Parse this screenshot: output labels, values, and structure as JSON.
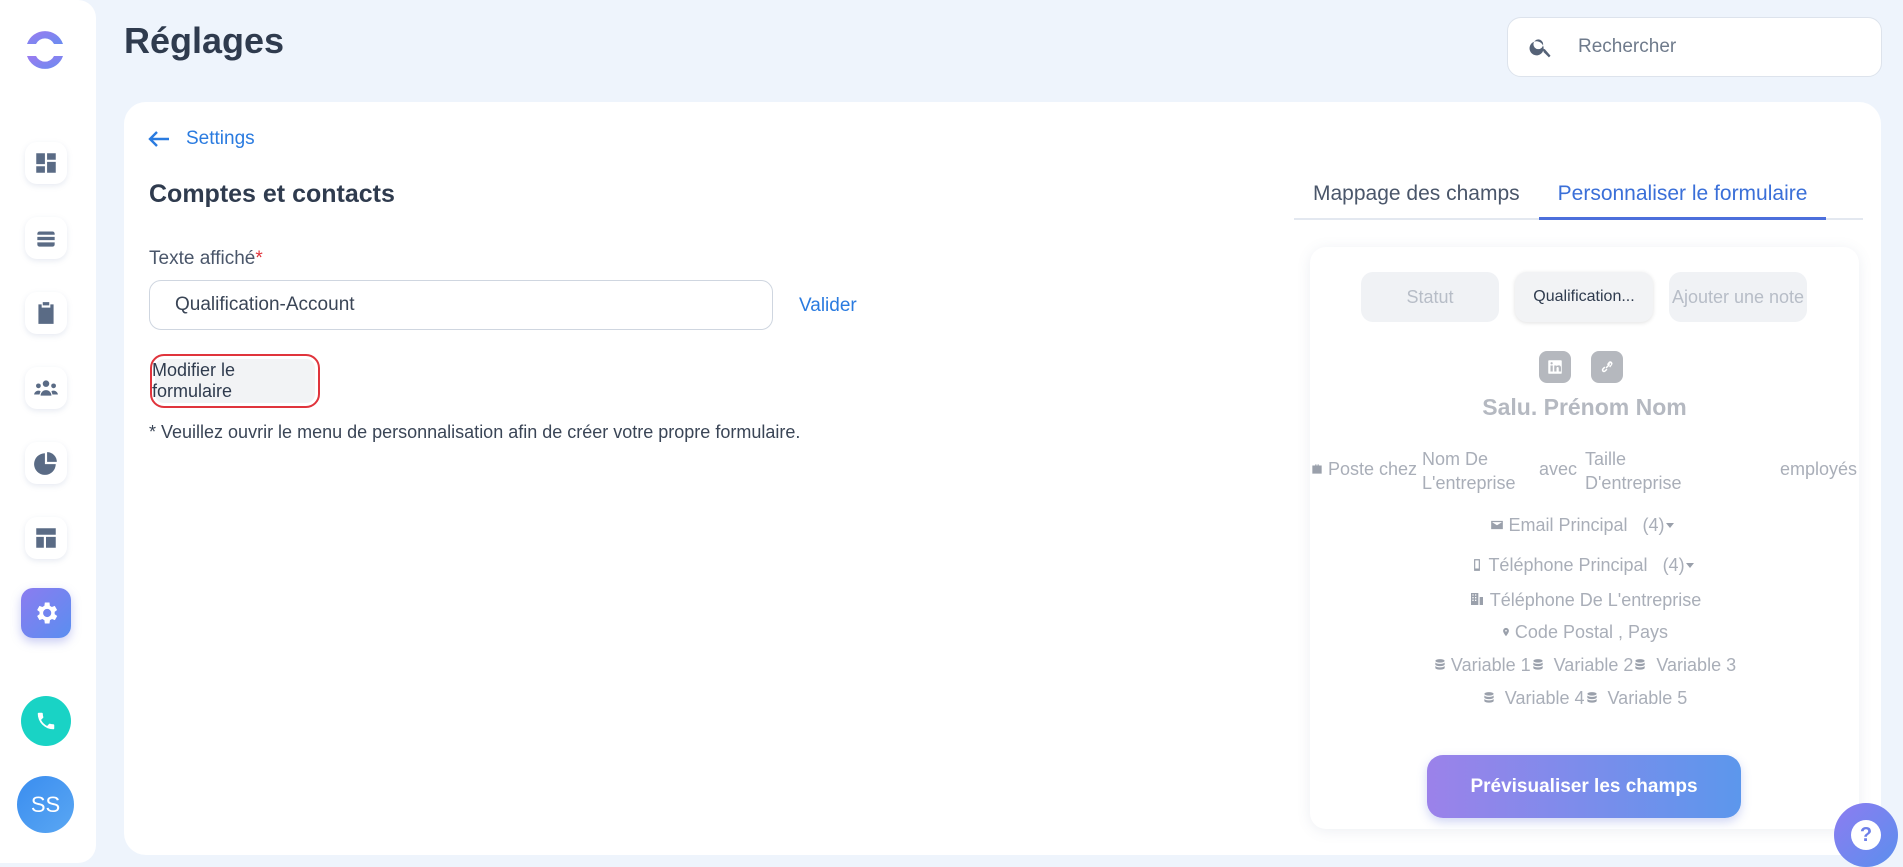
{
  "header": {
    "title": "Réglages",
    "search_placeholder": "Rechercher"
  },
  "sidebar": {
    "avatar_initials": "SS",
    "icons": [
      "dashboard-icon",
      "layers-icon",
      "clipboard-icon",
      "team-icon",
      "pie-chart-icon",
      "layout-icon",
      "gear-icon",
      "phone-icon"
    ]
  },
  "main": {
    "back_label": "Settings",
    "section_title": "Comptes et contacts",
    "field_label": "Texte affiché",
    "field_required_mark": "*",
    "field_value": "Qualification-Account",
    "validate_label": "Valider",
    "edit_form_label": "Modifier le formulaire",
    "hint": "* Veuillez ouvrir le menu de personnalisation afin de créer votre propre formulaire."
  },
  "tabs": [
    {
      "label": "Mappage des champs",
      "active": false
    },
    {
      "label": "Personnaliser le formulaire",
      "active": true
    }
  ],
  "preview": {
    "chips": [
      "Statut",
      "Qualification...",
      "Ajouter une note"
    ],
    "name": "Salu. Prénom Nom",
    "poste_chez": "Poste chez",
    "nom_entreprise": "Nom De L'entreprise",
    "avec": "avec",
    "taille_entreprise": "Taille D'entreprise",
    "employes": "employés",
    "email": "Email Principal",
    "email_count": "(4)",
    "telephone": "Téléphone Principal",
    "telephone_count": "(4)",
    "telephone_entreprise": "Téléphone De L'entreprise",
    "code_postal": "Code Postal",
    "separator": ",",
    "pays": "Pays",
    "variables": [
      "Variable 1",
      "Variable 2",
      "Variable 3",
      "Variable 4",
      "Variable 5"
    ],
    "preview_button": "Prévisualiser les champs"
  },
  "help_label": "?"
}
